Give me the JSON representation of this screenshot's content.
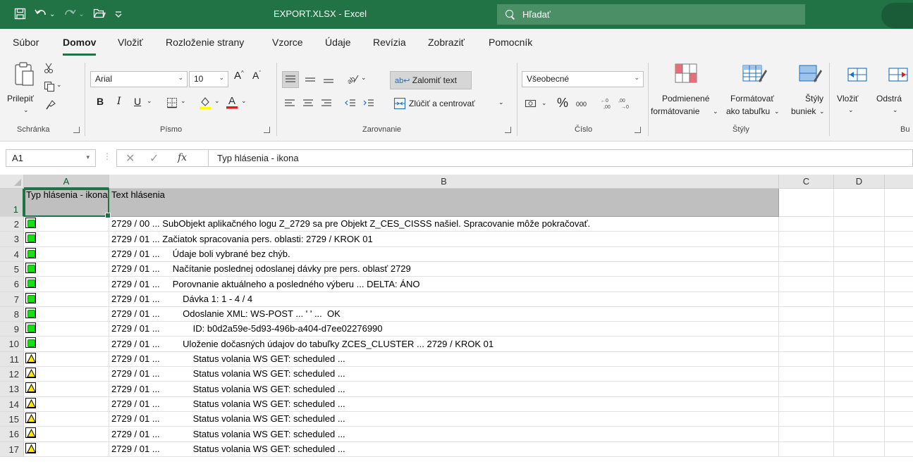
{
  "titlebar": {
    "doc_title": "EXPORT.XLSX  -  Excel",
    "search_label": "Hľadať"
  },
  "tabs": [
    {
      "label": "Súbor",
      "active": false
    },
    {
      "label": "Domov",
      "active": true
    },
    {
      "label": "Vložiť",
      "active": false
    },
    {
      "label": "Rozloženie strany",
      "active": false
    },
    {
      "label": "Vzorce",
      "active": false
    },
    {
      "label": "Údaje",
      "active": false
    },
    {
      "label": "Revízia",
      "active": false
    },
    {
      "label": "Zobraziť",
      "active": false
    },
    {
      "label": "Pomocník",
      "active": false
    }
  ],
  "ribbon": {
    "clipboard": {
      "paste_label": "Prilepiť",
      "group_label": "Schránka"
    },
    "font": {
      "font_name": "Arial",
      "font_size": "10",
      "bold": "B",
      "italic": "I",
      "underline": "U",
      "group_label": "Písmo"
    },
    "alignment": {
      "wrap_label": "Zalomiť text",
      "merge_label": "Zlúčiť a centrovať",
      "group_label": "Zarovnanie"
    },
    "number": {
      "format": "Všeobecné",
      "thousands": "000",
      "group_label": "Číslo"
    },
    "styles": {
      "cond_line1": "Podmienené",
      "cond_line2": "formátovanie",
      "table_line1": "Formátovať",
      "table_line2": "ako tabuľku",
      "cell_line1": "Štýly",
      "cell_line2": "buniek",
      "group_label": "Štýly"
    },
    "cells": {
      "insert_label": "Vložiť",
      "delete_label": "Odstrá",
      "group_label": "Bu"
    }
  },
  "formula_bar": {
    "name_box": "A1",
    "fx": "fx",
    "content": "Typ hlásenia - ikona"
  },
  "columns": [
    "A",
    "B",
    "C",
    "D"
  ],
  "header_row": {
    "row_number": "1",
    "a": "Typ hlásenia - ikona",
    "b": "Text hlásenia"
  },
  "rows": [
    {
      "n": "2",
      "status": "ok",
      "text": "2729 / 00 ... SubObjekt aplikačného logu Z_2729 sa pre Objekt Z_CES_CISSS našiel. Spracovanie môže pokračovať."
    },
    {
      "n": "3",
      "status": "ok",
      "text": "2729 / 01 ... Začiatok spracovania pers. oblasti: 2729 / KROK 01"
    },
    {
      "n": "4",
      "status": "ok",
      "text": "2729 / 01 ...     Údaje boli vybrané bez chýb."
    },
    {
      "n": "5",
      "status": "ok",
      "text": "2729 / 01 ...     Načítanie poslednej odoslanej dávky pre pers. oblasť 2729"
    },
    {
      "n": "6",
      "status": "ok",
      "text": "2729 / 01 ...     Porovnanie aktuálneho a posledného výberu ... DELTA: ÁNO"
    },
    {
      "n": "7",
      "status": "ok",
      "text": "2729 / 01 ...         Dávka 1: 1 - 4 / 4"
    },
    {
      "n": "8",
      "status": "ok",
      "text": "2729 / 01 ...         Odoslanie XML: WS-POST ... ' ' ...  OK"
    },
    {
      "n": "9",
      "status": "ok",
      "text": "2729 / 01 ...             ID: b0d2a59e-5d93-496b-a404-d7ee02276990"
    },
    {
      "n": "10",
      "status": "ok",
      "text": "2729 / 01 ...         Uloženie dočasných údajov do tabuľky ZCES_CLUSTER ... 2729 / KROK 01"
    },
    {
      "n": "11",
      "status": "warn",
      "text": "2729 / 01 ...             Status volania WS GET: scheduled ..."
    },
    {
      "n": "12",
      "status": "warn",
      "text": "2729 / 01 ...             Status volania WS GET: scheduled ..."
    },
    {
      "n": "13",
      "status": "warn",
      "text": "2729 / 01 ...             Status volania WS GET: scheduled ..."
    },
    {
      "n": "14",
      "status": "warn",
      "text": "2729 / 01 ...             Status volania WS GET: scheduled ..."
    },
    {
      "n": "15",
      "status": "warn",
      "text": "2729 / 01 ...             Status volania WS GET: scheduled ..."
    },
    {
      "n": "16",
      "status": "warn",
      "text": "2729 / 01 ...             Status volania WS GET: scheduled ..."
    },
    {
      "n": "17",
      "status": "warn",
      "text": "2729 / 01 ...             Status volania WS GET: scheduled ..."
    }
  ],
  "icons": {
    "ok": "green-square-status-icon",
    "warn": "yellow-triangle-warning-icon"
  },
  "colors": {
    "excel_green": "#217346",
    "ok_green": "#14e014",
    "warn_yellow": "#ffe600",
    "header_fill": "#bfbfbf"
  }
}
